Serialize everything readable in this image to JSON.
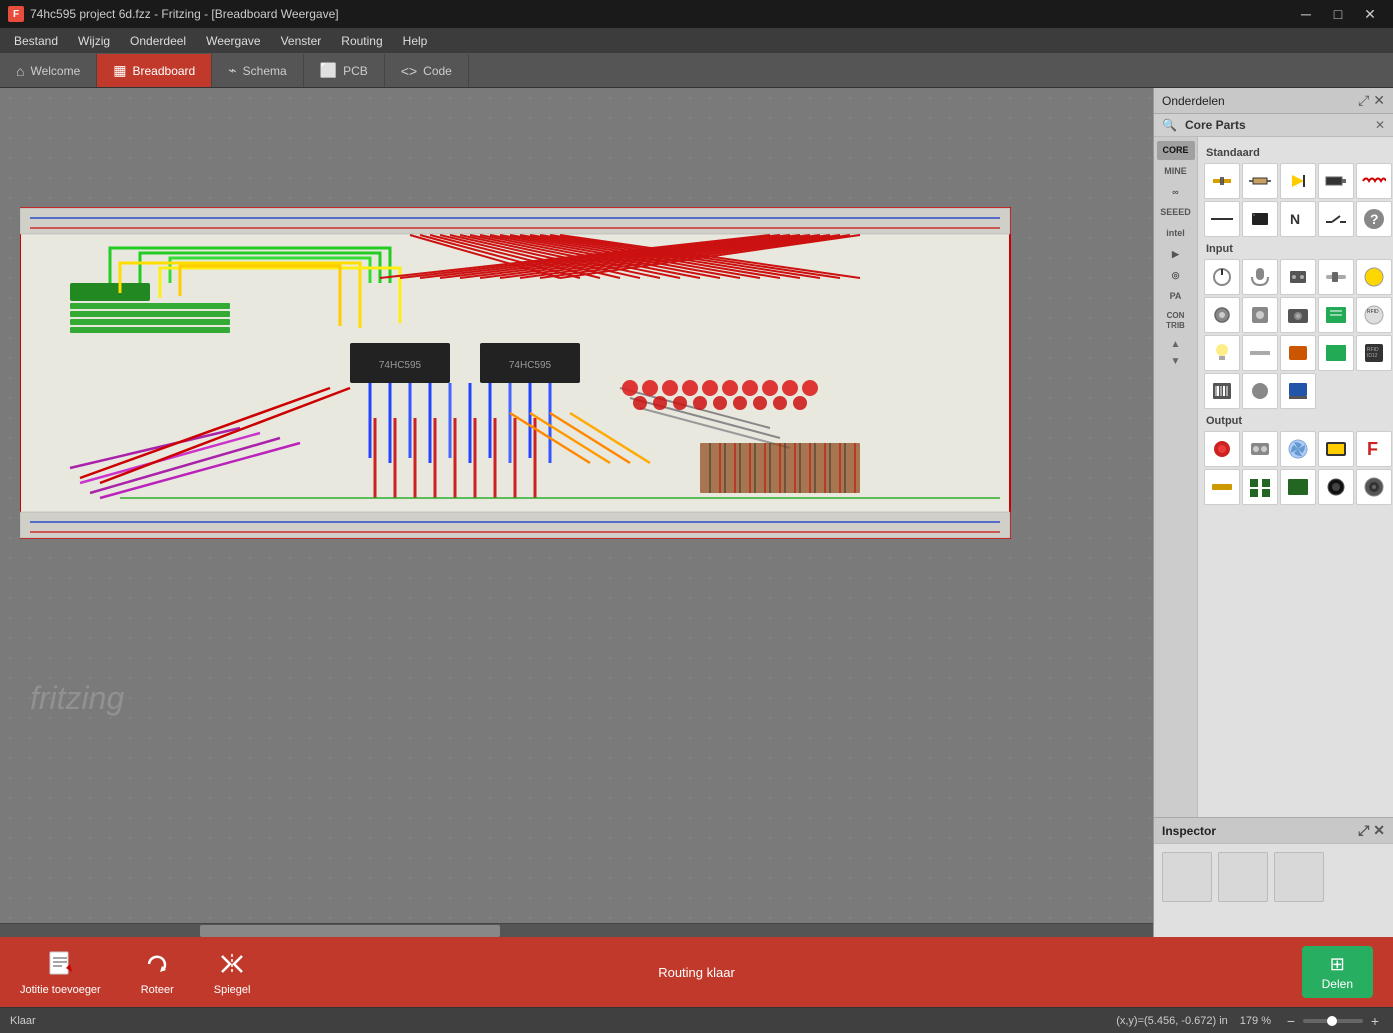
{
  "titlebar": {
    "icon_text": "F",
    "title": "74hc595 project 6d.fzz - Fritzing - [Breadboard Weergave]",
    "btn_minimize": "─",
    "btn_restore": "□",
    "btn_close": "✕"
  },
  "menubar": {
    "items": [
      {
        "label": "Bestand"
      },
      {
        "label": "Wijzig"
      },
      {
        "label": "Onderdeel"
      },
      {
        "label": "Weergave"
      },
      {
        "label": "Venster"
      },
      {
        "label": "Routing"
      },
      {
        "label": "Help"
      }
    ]
  },
  "tabbar": {
    "tabs": [
      {
        "label": "Welcome",
        "icon": "⌂",
        "active": false
      },
      {
        "label": "Breadboard",
        "icon": "▦",
        "active": true
      },
      {
        "label": "Schema",
        "icon": "⌁",
        "active": false
      },
      {
        "label": "PCB",
        "icon": "⬜",
        "active": false
      },
      {
        "label": "Code",
        "icon": "<>",
        "active": false
      }
    ]
  },
  "parts_panel": {
    "header_title": "Onderdelen",
    "search_placeholder": "",
    "section_title": "Core Parts",
    "subsection_standard": "Standaard",
    "subsection_input": "Input",
    "subsection_output": "Output",
    "cat_tabs": [
      {
        "label": "CORE",
        "active": true
      },
      {
        "label": "MINE"
      },
      {
        "label": "∞"
      },
      {
        "label": "SEEED"
      },
      {
        "label": "intel"
      },
      {
        "label": "▶"
      },
      {
        "label": "◎"
      },
      {
        "label": "PA"
      },
      {
        "label": "CON TRIB"
      }
    ],
    "standard_parts": [
      "🔵",
      "🔌",
      "🟡",
      "⚫",
      "〰",
      "➖",
      "⬛",
      "N",
      "⬛",
      "?"
    ],
    "input_parts": [
      "⚙",
      "🎤",
      "🔌",
      "▬",
      "⭕",
      "⚙",
      "⚙",
      "⚙",
      "⚙",
      "⭐",
      "➖",
      "🔄",
      "⬛",
      "✦",
      "🔴",
      "⬛",
      "🟢",
      "⬛",
      "⬛"
    ],
    "output_parts": [
      "🔴",
      "⬛",
      "🌀",
      "🎯",
      "F",
      "⬛",
      "⬛",
      "⬛",
      "⬛",
      "⬛"
    ]
  },
  "inspector": {
    "header": "Inspector",
    "boxes": [
      "",
      "",
      ""
    ]
  },
  "toolbar": {
    "buttons": [
      {
        "label": "Jotitie toevoeger",
        "icon": "📄"
      },
      {
        "label": "Roteer",
        "icon": "↺"
      },
      {
        "label": "Spiegel",
        "icon": "⟺"
      }
    ],
    "status_text": "Routing klaar",
    "delen_label": "Delen",
    "delen_icon": "⊞"
  },
  "statusbar": {
    "left": "Klaar",
    "coords": "(x,y)=(5.456, -0.672) in",
    "zoom": "179 %",
    "zoom_minus": "−",
    "zoom_plus": "+"
  }
}
